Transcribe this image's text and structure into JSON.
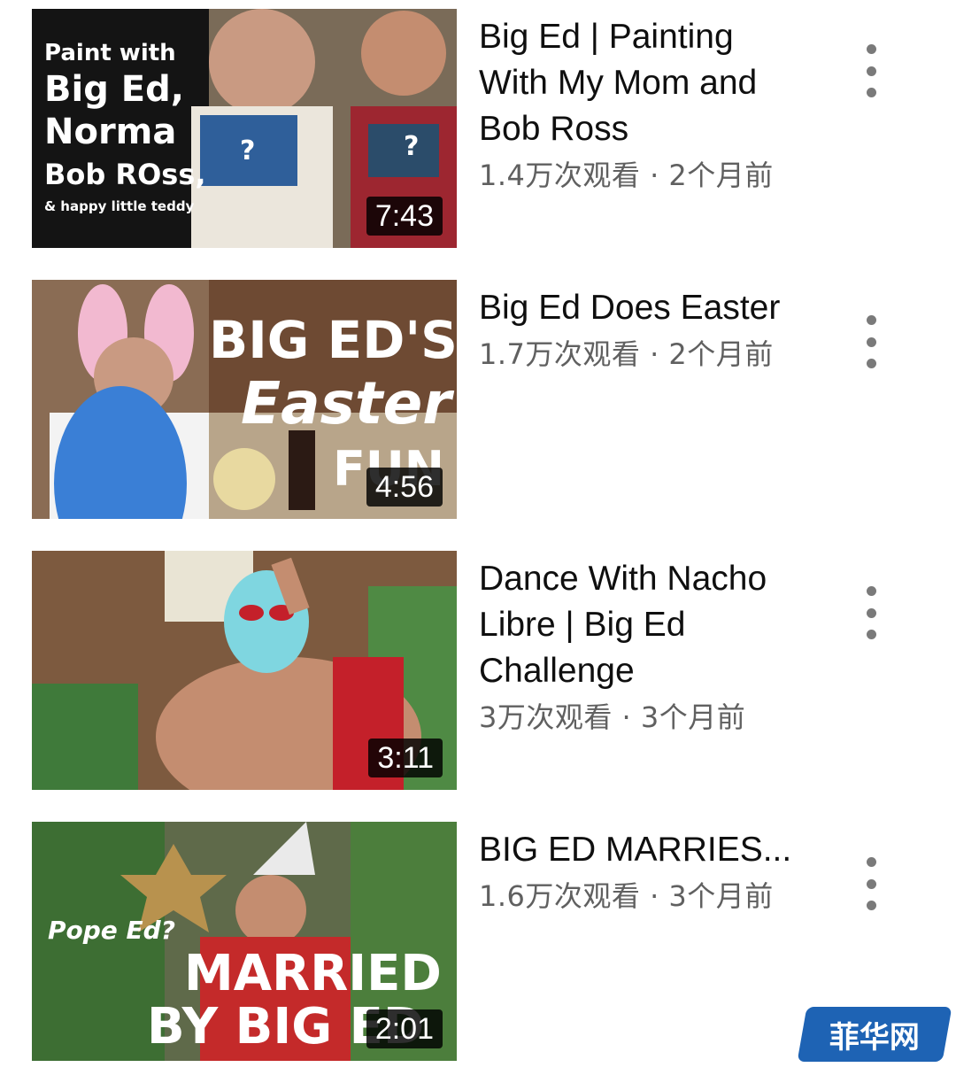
{
  "videos": [
    {
      "title": "Big Ed | Painting With My Mom and Bob Ross",
      "meta": "1.4万次观看 · 2个月前",
      "duration": "7:43",
      "thumb_text": [
        "Paint with",
        "Big Ed,",
        "Norma",
        "Bob ROss,",
        "& happy little teddy"
      ]
    },
    {
      "title": "Big Ed Does Easter",
      "meta": "1.7万次观看 · 2个月前",
      "duration": "4:56",
      "thumb_text": [
        "BIG ED'S",
        "Easter",
        "FUN"
      ]
    },
    {
      "title": "Dance With Nacho Libre | Big Ed Challenge",
      "meta": "3万次观看 · 3个月前",
      "duration": "3:11",
      "thumb_text": []
    },
    {
      "title": "BIG ED MARRIES...",
      "meta": "1.6万次观看 · 3个月前",
      "duration": "2:01",
      "thumb_text": [
        "Pope Ed?",
        "MARRIED",
        "BY BIG ED"
      ]
    }
  ],
  "watermark": "菲华网"
}
